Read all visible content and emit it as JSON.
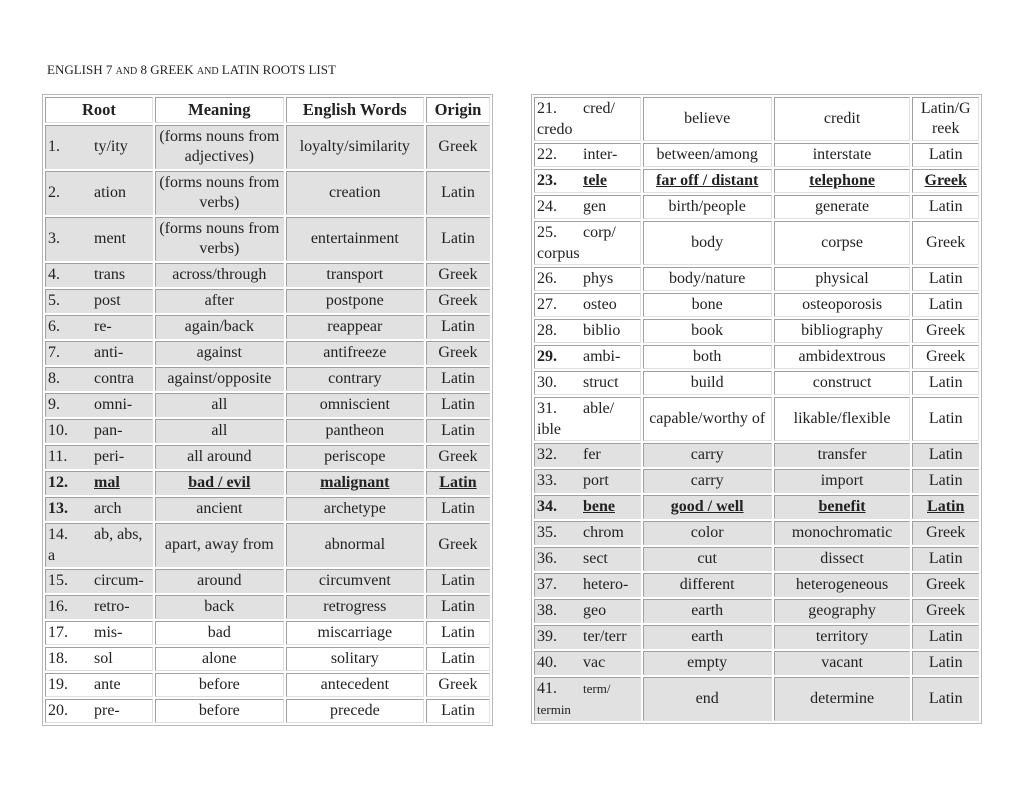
{
  "title": {
    "part1": "ENGLISH 7 ",
    "part2": "AND",
    "part3": " 8 GREEK ",
    "part4": "AND",
    "part5": " LATIN ROOTS LIST"
  },
  "headers": {
    "root": "Root",
    "meaning": "Meaning",
    "words": "English Words",
    "origin": "Origin"
  },
  "left_rows": [
    {
      "num": "1.",
      "root": "ty/ity",
      "meaning": "(forms nouns from adjectives)",
      "word": "loyalty/similarity",
      "origin": "Greek"
    },
    {
      "num": "2.",
      "root": "ation",
      "meaning": "(forms nouns from verbs)",
      "word": "creation",
      "origin": "Latin"
    },
    {
      "num": "3.",
      "root": "ment",
      "meaning": "(forms nouns from verbs)",
      "word": "entertainment",
      "origin": "Latin"
    },
    {
      "num": "4.",
      "root": "trans",
      "meaning": "across/through",
      "word": "transport",
      "origin": "Greek"
    },
    {
      "num": "5.",
      "root": "post",
      "meaning": "after",
      "word": "postpone",
      "origin": "Greek"
    },
    {
      "num": "6.",
      "root": "re-",
      "meaning": "again/back",
      "word": "reappear",
      "origin": "Latin"
    },
    {
      "num": "7.",
      "root": "anti-",
      "meaning": "against",
      "word": "antifreeze",
      "origin": "Greek"
    },
    {
      "num": "8.",
      "root": "contra",
      "meaning": "against/opposite",
      "word": "contrary",
      "origin": "Latin"
    },
    {
      "num": "9.",
      "root": "omni-",
      "meaning": "all",
      "word": "omniscient",
      "origin": "Latin"
    },
    {
      "num": "10.",
      "root": "pan-",
      "meaning": "all",
      "word": "pantheon",
      "origin": "Latin"
    },
    {
      "num": "11.",
      "root": "peri-",
      "meaning": "all around",
      "word": "periscope",
      "origin": "Greek"
    },
    {
      "num": "12.",
      "root": "mal",
      "meaning": "bad / evil",
      "word": "malignant",
      "origin": "Latin"
    },
    {
      "num": "13.",
      "root": "arch",
      "meaning": "ancient",
      "word": "archetype",
      "origin": "Latin"
    },
    {
      "num": "14.",
      "root": "ab, abs, a",
      "meaning": "apart, away from",
      "word": "abnormal",
      "origin": "Greek"
    },
    {
      "num": "15.",
      "root": "circum-",
      "meaning": "around",
      "word": "circumvent",
      "origin": "Latin"
    },
    {
      "num": "16.",
      "root": "retro-",
      "meaning": "back",
      "word": "retrogress",
      "origin": "Latin"
    },
    {
      "num": "17.",
      "root": "mis-",
      "meaning": "bad",
      "word": "miscarriage",
      "origin": "Latin"
    },
    {
      "num": "18.",
      "root": "sol",
      "meaning": "alone",
      "word": "solitary",
      "origin": "Latin"
    },
    {
      "num": "19.",
      "root": "ante",
      "meaning": "before",
      "word": "antecedent",
      "origin": "Greek"
    },
    {
      "num": "20.",
      "root": "pre-",
      "meaning": "before",
      "word": "precede",
      "origin": "Latin"
    }
  ],
  "right_rows": [
    {
      "num": "21.",
      "root": "cred/ credo",
      "meaning": "believe",
      "word": "credit",
      "origin": "Latin/G reek"
    },
    {
      "num": "22.",
      "root": "inter-",
      "meaning": "between/among",
      "word": "interstate",
      "origin": "Latin"
    },
    {
      "num": "23.",
      "root": "tele",
      "meaning": "far off / distant",
      "word": "telephone",
      "origin": "Greek"
    },
    {
      "num": "24.",
      "root": "gen",
      "meaning": "birth/people",
      "word": "generate",
      "origin": "Latin"
    },
    {
      "num": "25.",
      "root": "corp/ corpus",
      "meaning": "body",
      "word": "corpse",
      "origin": "Greek"
    },
    {
      "num": "26.",
      "root": "phys",
      "meaning": "body/nature",
      "word": "physical",
      "origin": "Latin"
    },
    {
      "num": "27.",
      "root": "osteo",
      "meaning": "bone",
      "word": "osteoporosis",
      "origin": "Latin"
    },
    {
      "num": "28.",
      "root": "biblio",
      "meaning": "book",
      "word": "bibliography",
      "origin": "Greek"
    },
    {
      "num": "29.",
      "root": "ambi-",
      "meaning": "both",
      "word": "ambidextrous",
      "origin": "Greek"
    },
    {
      "num": "30.",
      "root": "struct",
      "meaning": "build",
      "word": "construct",
      "origin": "Latin"
    },
    {
      "num": "31.",
      "root": "able/ ible",
      "meaning": "capable/worthy of",
      "word": "likable/flexible",
      "origin": "Latin"
    },
    {
      "num": "32.",
      "root": "fer",
      "meaning": "carry",
      "word": "transfer",
      "origin": "Latin"
    },
    {
      "num": "33.",
      "root": "port",
      "meaning": "carry",
      "word": "import",
      "origin": "Latin"
    },
    {
      "num": "34.",
      "root": "bene",
      "meaning": "good / well",
      "word": "benefit",
      "origin": "Latin"
    },
    {
      "num": "35.",
      "root": "chrom",
      "meaning": "color",
      "word": "monochromatic",
      "origin": "Greek"
    },
    {
      "num": "36.",
      "root": "sect",
      "meaning": "cut",
      "word": "dissect",
      "origin": "Latin"
    },
    {
      "num": "37.",
      "root": "hetero-",
      "meaning": "different",
      "word": "heterogeneous",
      "origin": "Greek"
    },
    {
      "num": "38.",
      "root": "geo",
      "meaning": "earth",
      "word": "geography",
      "origin": "Greek"
    },
    {
      "num": "39.",
      "root": "ter/terr",
      "meaning": "earth",
      "word": "territory",
      "origin": "Latin"
    },
    {
      "num": "40.",
      "root": "vac",
      "meaning": "empty",
      "word": "vacant",
      "origin": "Latin"
    },
    {
      "num": "41.",
      "root": "term/ termin",
      "meaning": "end",
      "word": "determine",
      "origin": "Latin"
    }
  ]
}
